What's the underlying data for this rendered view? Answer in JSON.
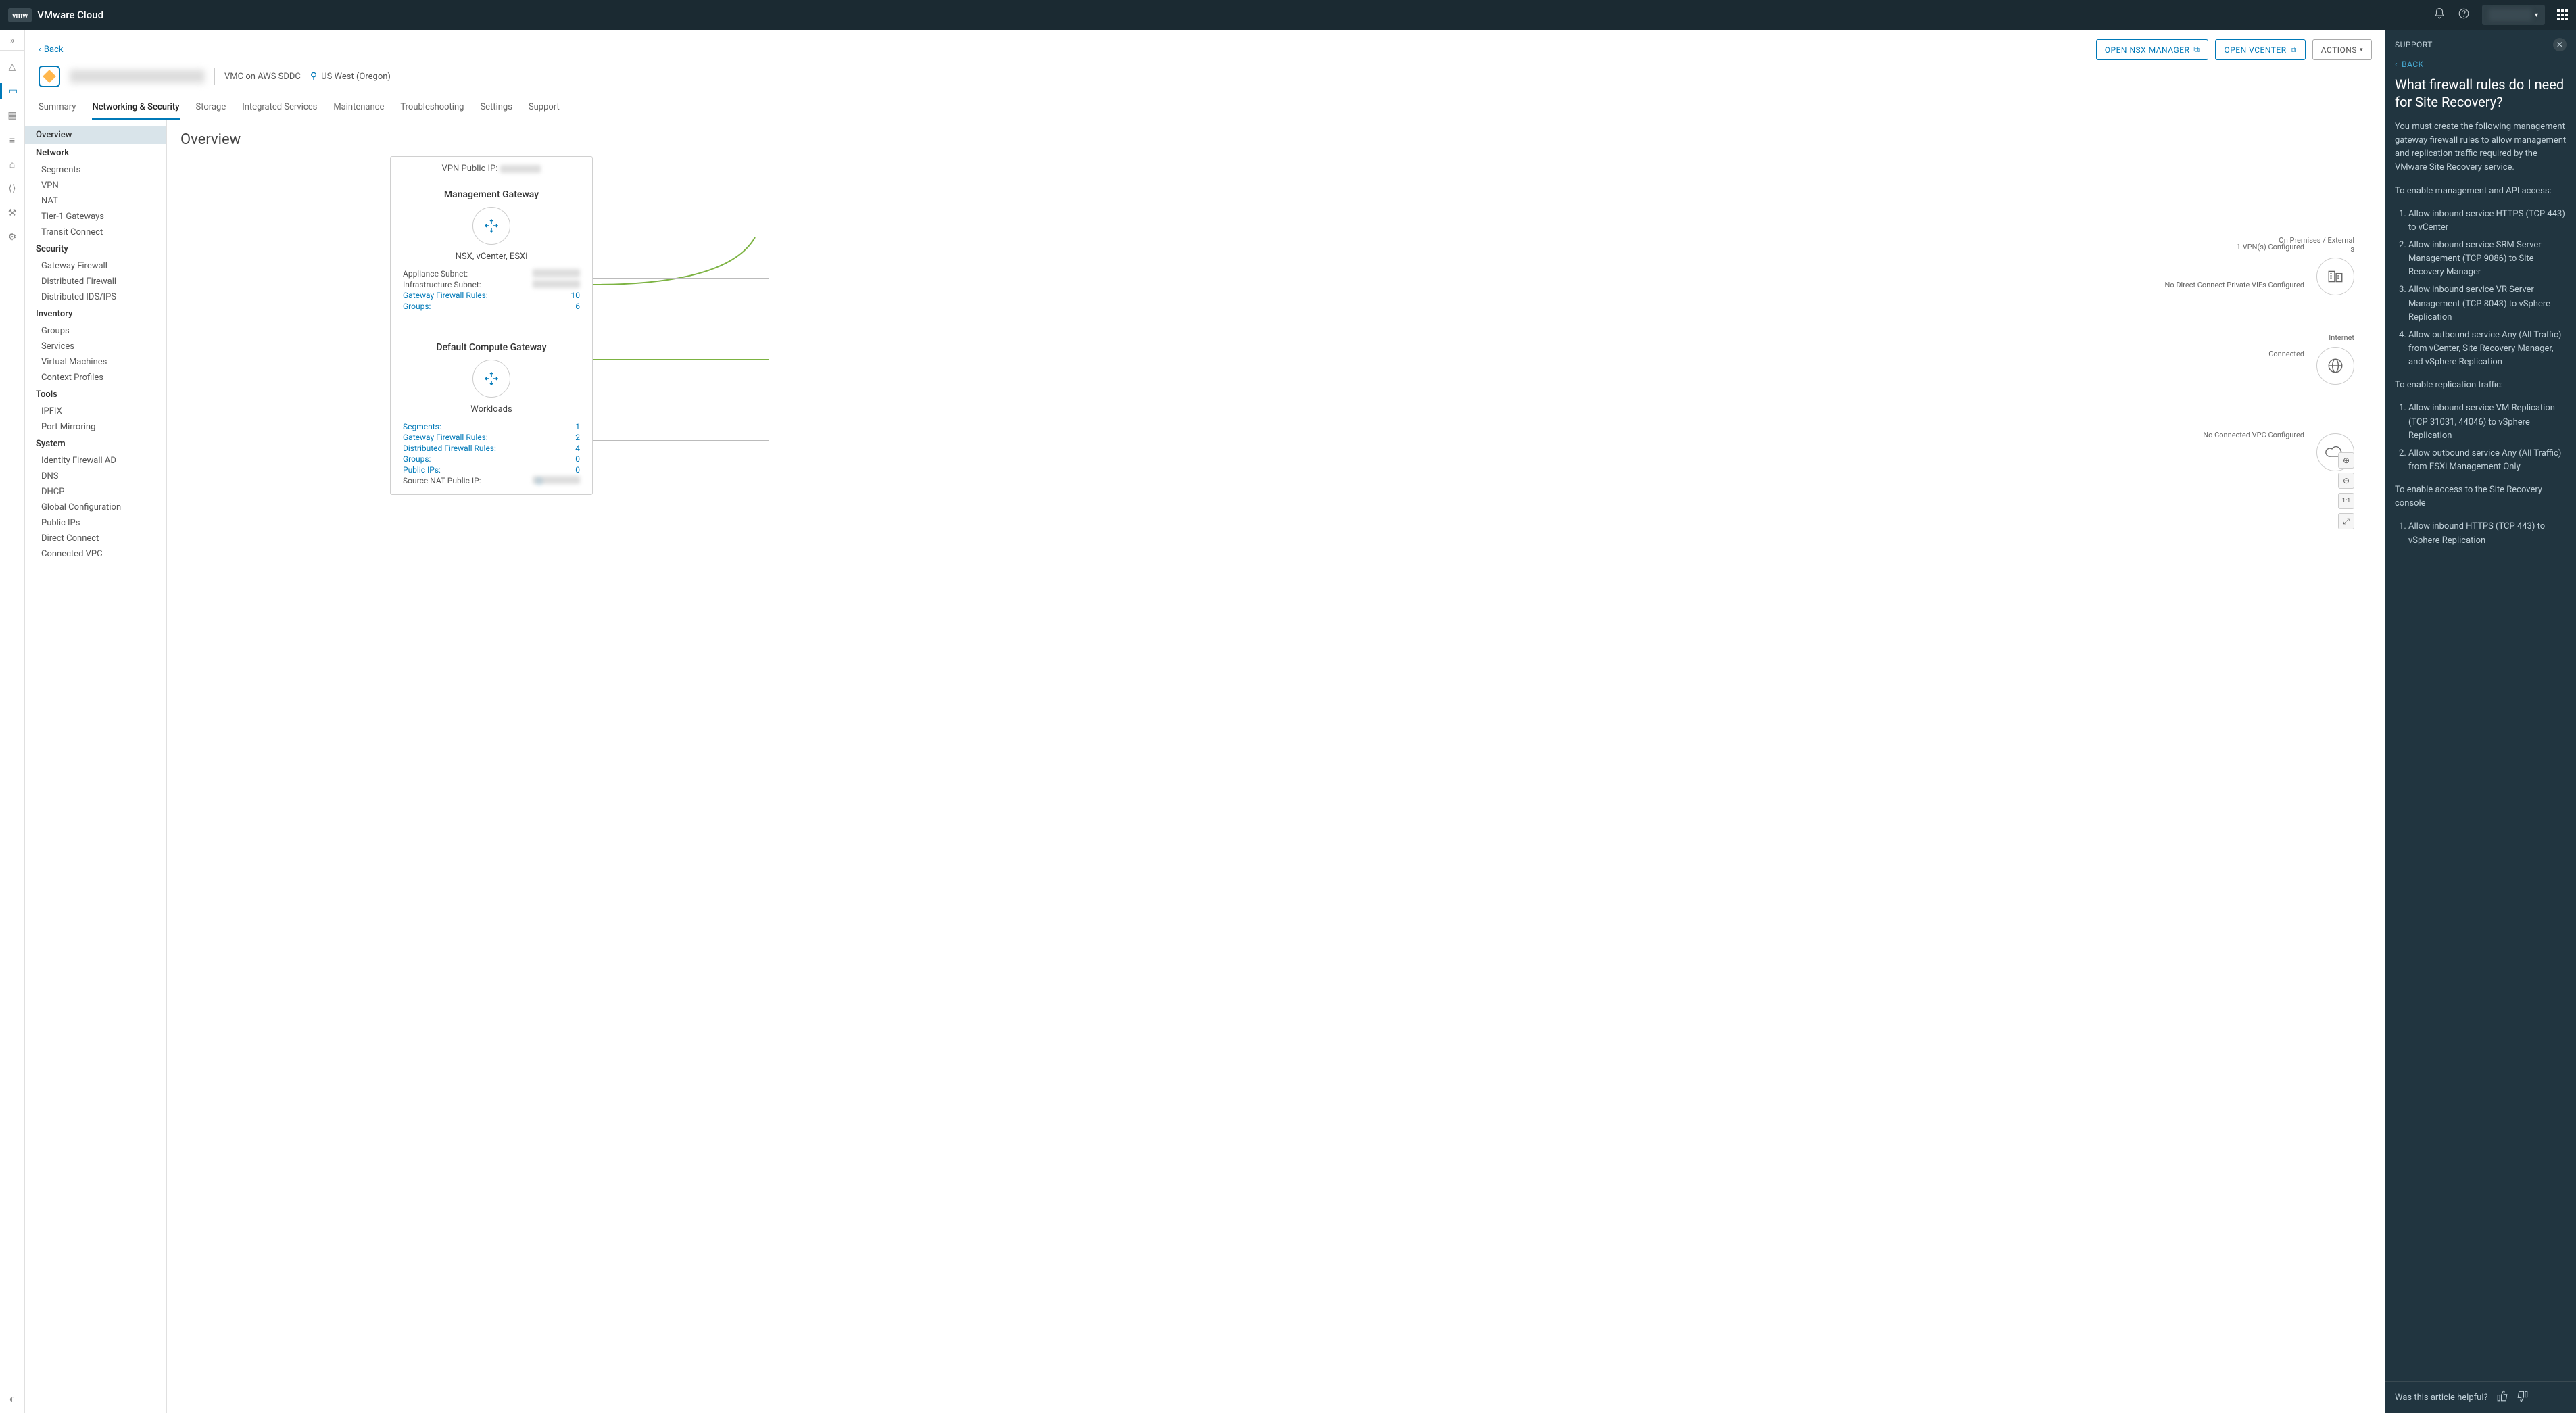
{
  "header": {
    "brand": "VMware Cloud",
    "logo": "vmw"
  },
  "page": {
    "back": "Back",
    "open_nsx": "OPEN NSX MANAGER",
    "open_vcenter": "OPEN VCENTER",
    "actions": "ACTIONS",
    "sddc_type": "VMC on AWS SDDC",
    "region": "US West (Oregon)"
  },
  "tabs": [
    "Summary",
    "Networking & Security",
    "Storage",
    "Integrated Services",
    "Maintenance",
    "Troubleshooting",
    "Settings",
    "Support"
  ],
  "sidenav": {
    "overview": "Overview",
    "groups": [
      {
        "title": "Network",
        "items": [
          "Segments",
          "VPN",
          "NAT",
          "Tier-1 Gateways",
          "Transit Connect"
        ]
      },
      {
        "title": "Security",
        "items": [
          "Gateway Firewall",
          "Distributed Firewall",
          "Distributed IDS/IPS"
        ]
      },
      {
        "title": "Inventory",
        "items": [
          "Groups",
          "Services",
          "Virtual Machines",
          "Context Profiles"
        ]
      },
      {
        "title": "Tools",
        "items": [
          "IPFIX",
          "Port Mirroring"
        ]
      },
      {
        "title": "System",
        "items": [
          "Identity Firewall AD",
          "DNS",
          "DHCP",
          "Global Configuration",
          "Public IPs",
          "Direct Connect",
          "Connected VPC"
        ]
      }
    ]
  },
  "overview": {
    "title": "Overview",
    "vpn_label": "VPN Public IP:",
    "mgmt": {
      "title": "Management Gateway",
      "sub": "NSX, vCenter, ESXi",
      "rows": [
        {
          "k": "Appliance Subnet:",
          "v": "",
          "blur": true
        },
        {
          "k": "Infrastructure Subnet:",
          "v": "",
          "blur": true
        },
        {
          "k": "Gateway Firewall Rules:",
          "v": "10",
          "link": true
        },
        {
          "k": "Groups:",
          "v": "6",
          "link": true
        }
      ]
    },
    "compute": {
      "title": "Default Compute Gateway",
      "sub": "Workloads",
      "rows": [
        {
          "k": "Segments:",
          "v": "1",
          "link": true
        },
        {
          "k": "Gateway Firewall Rules:",
          "v": "2",
          "link": true
        },
        {
          "k": "Distributed Firewall Rules:",
          "v": "4",
          "link": true
        },
        {
          "k": "Groups:",
          "v": "0",
          "link": true
        },
        {
          "k": "Public IPs:",
          "v": "0",
          "link": true
        },
        {
          "k": "Source NAT Public IP:",
          "v": "",
          "blur": true,
          "info": true
        }
      ]
    },
    "edges": {
      "vpn": "1 VPN(s) Configured",
      "onprem": "On Premises / External s",
      "dc": "No Direct Connect Private VIFs Configured",
      "internet": "Internet",
      "connected": "Connected",
      "vpc": "No Connected VPC Configured"
    }
  },
  "support": {
    "head": "SUPPORT",
    "back": "BACK",
    "title": "What firewall rules do I need for Site Recovery?",
    "intro": "You must create the following management gateway firewall rules to allow management and replication traffic required by the VMware Site Recovery service.",
    "sec1_title": "To enable management and API access:",
    "sec1": [
      "Allow inbound service HTTPS (TCP 443) to vCenter",
      "Allow inbound service SRM Server Management (TCP 9086) to Site Recovery Manager",
      "Allow inbound service VR Server Management (TCP 8043) to vSphere Replication",
      "Allow outbound service Any (All Traffic) from vCenter, Site Recovery Manager, and vSphere Replication"
    ],
    "sec2_title": "To enable replication traffic:",
    "sec2": [
      "Allow inbound service VM Replication (TCP 31031, 44046) to vSphere Replication",
      "Allow outbound service Any (All Traffic) from ESXi Management Only"
    ],
    "sec3_title": "To enable access to the Site Recovery console",
    "sec3": [
      "Allow inbound HTTPS (TCP 443) to vSphere Replication"
    ],
    "helpful": "Was this article helpful?"
  }
}
